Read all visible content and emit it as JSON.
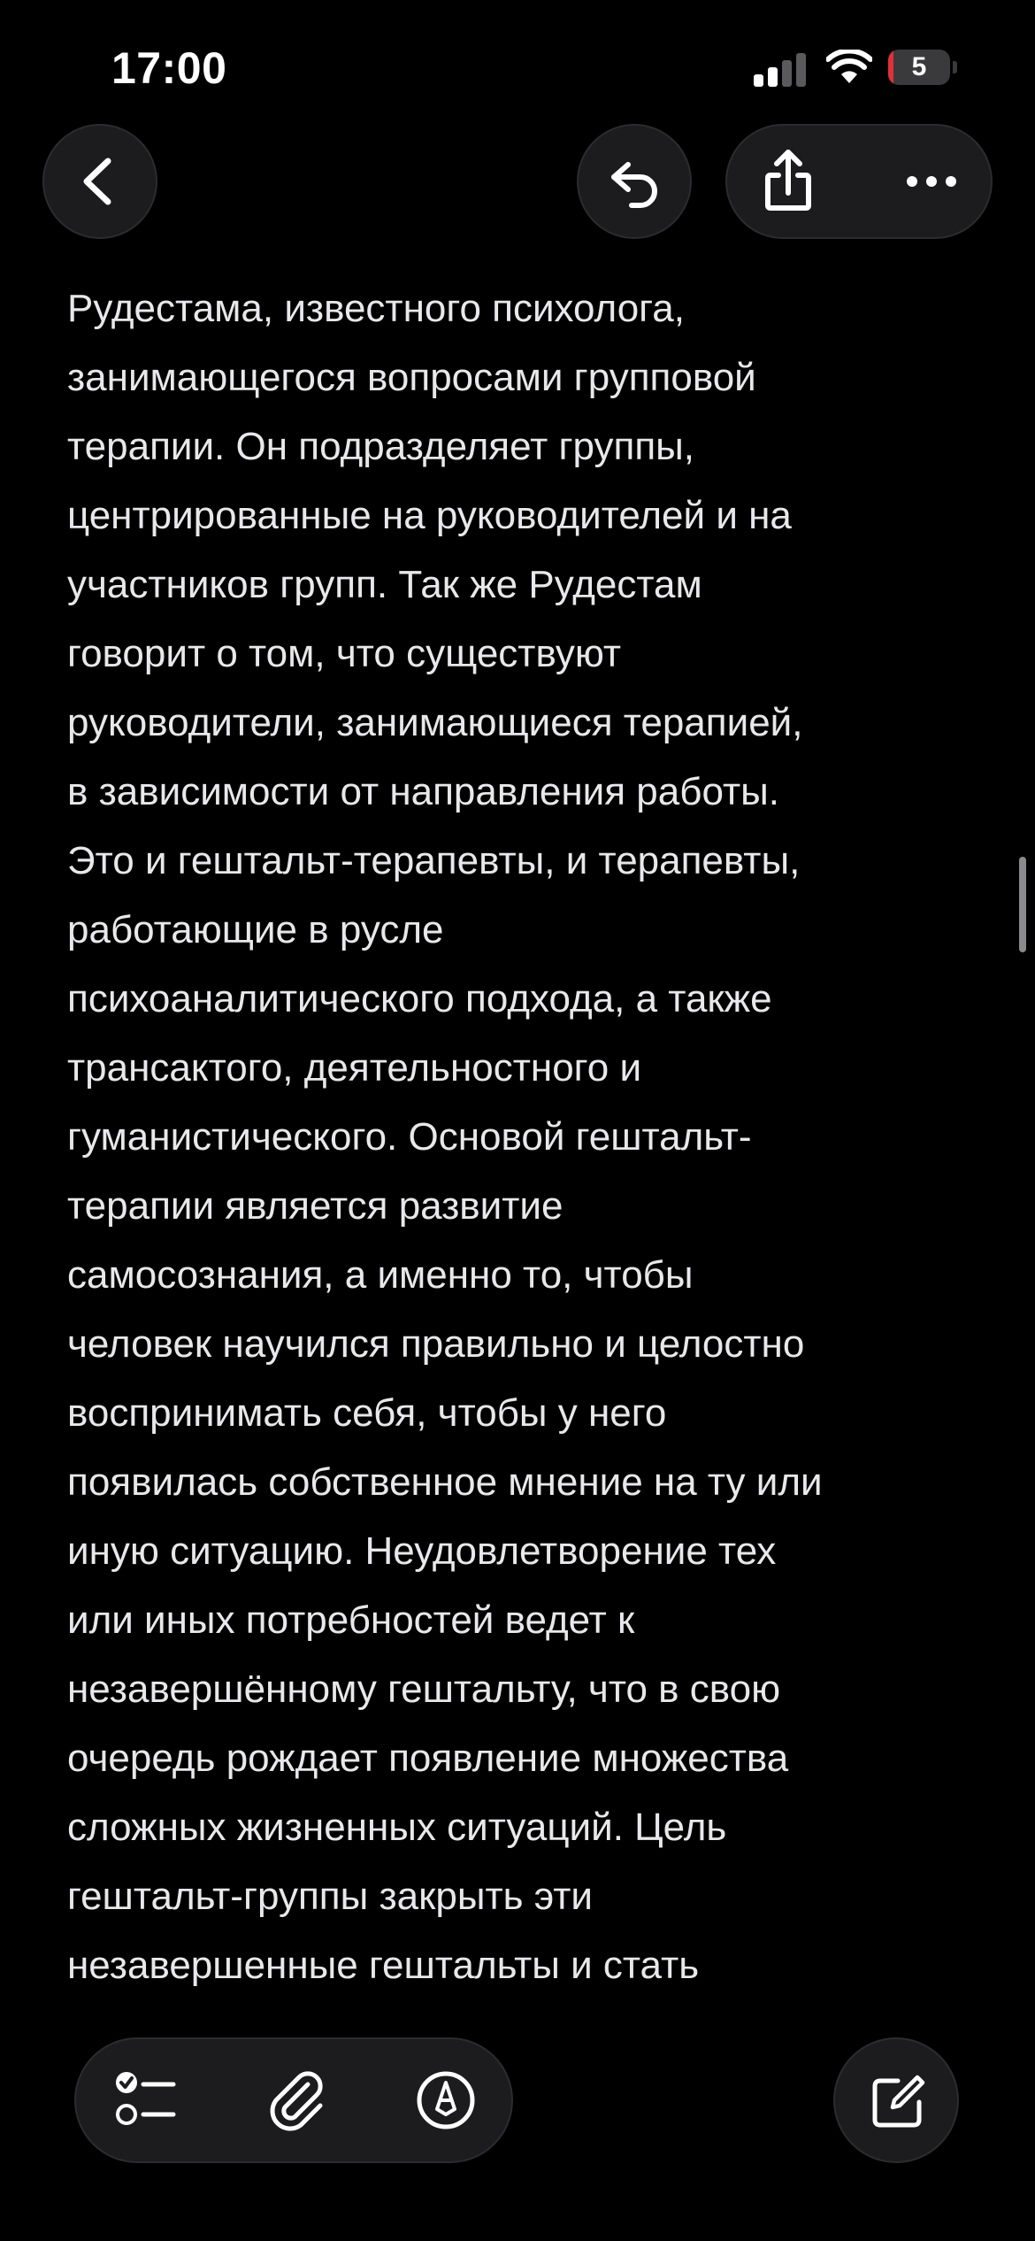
{
  "status_bar": {
    "time": "17:00",
    "battery_percent": "5",
    "battery_level": 0.05,
    "signal_bars_active": 2,
    "signal_bars_total": 4,
    "battery_color": "#e0313a"
  },
  "nav": {
    "back_icon": "chevron-left-icon",
    "undo_icon": "undo-icon",
    "share_icon": "share-icon",
    "more_icon": "ellipsis-icon"
  },
  "note": {
    "lines": [
      "Рудестама, известного психолога,",
      "занимающегося вопросами групповой",
      "терапии. Он подразделяет группы,",
      "центрированные на руководителей и на",
      "участников групп. Так же Рудестам",
      "говорит о том, что существуют",
      "руководители, занимающиеся терапией,",
      "в зависимости от направления работы.",
      "Это и гештальт-терапевты, и терапевты,",
      "работающие в русле",
      "психоаналитического подхода, а также",
      "трансактого, деятельностного и",
      "гуманистического. Основой гештальт-",
      "терапии является развитие",
      "самосознания, а именно то, чтобы",
      "человек научился правильно и целостно",
      "воспринимать себя, чтобы у него",
      "появилась собственное мнение на ту или",
      "иную ситуацию. Неудовлетворение тех",
      "или иных потребностей ведет к",
      "незавершённому гештальту, что в свою",
      "очередь рождает появление множества",
      "сложных жизненных ситуаций. Цель",
      "гештальт-группы закрыть эти",
      "незавершенные гештальты и стать"
    ]
  },
  "toolbar": {
    "checklist_icon": "checklist-icon",
    "attachment_icon": "paperclip-icon",
    "markup_icon": "markup-pen-icon",
    "compose_icon": "compose-icon"
  }
}
